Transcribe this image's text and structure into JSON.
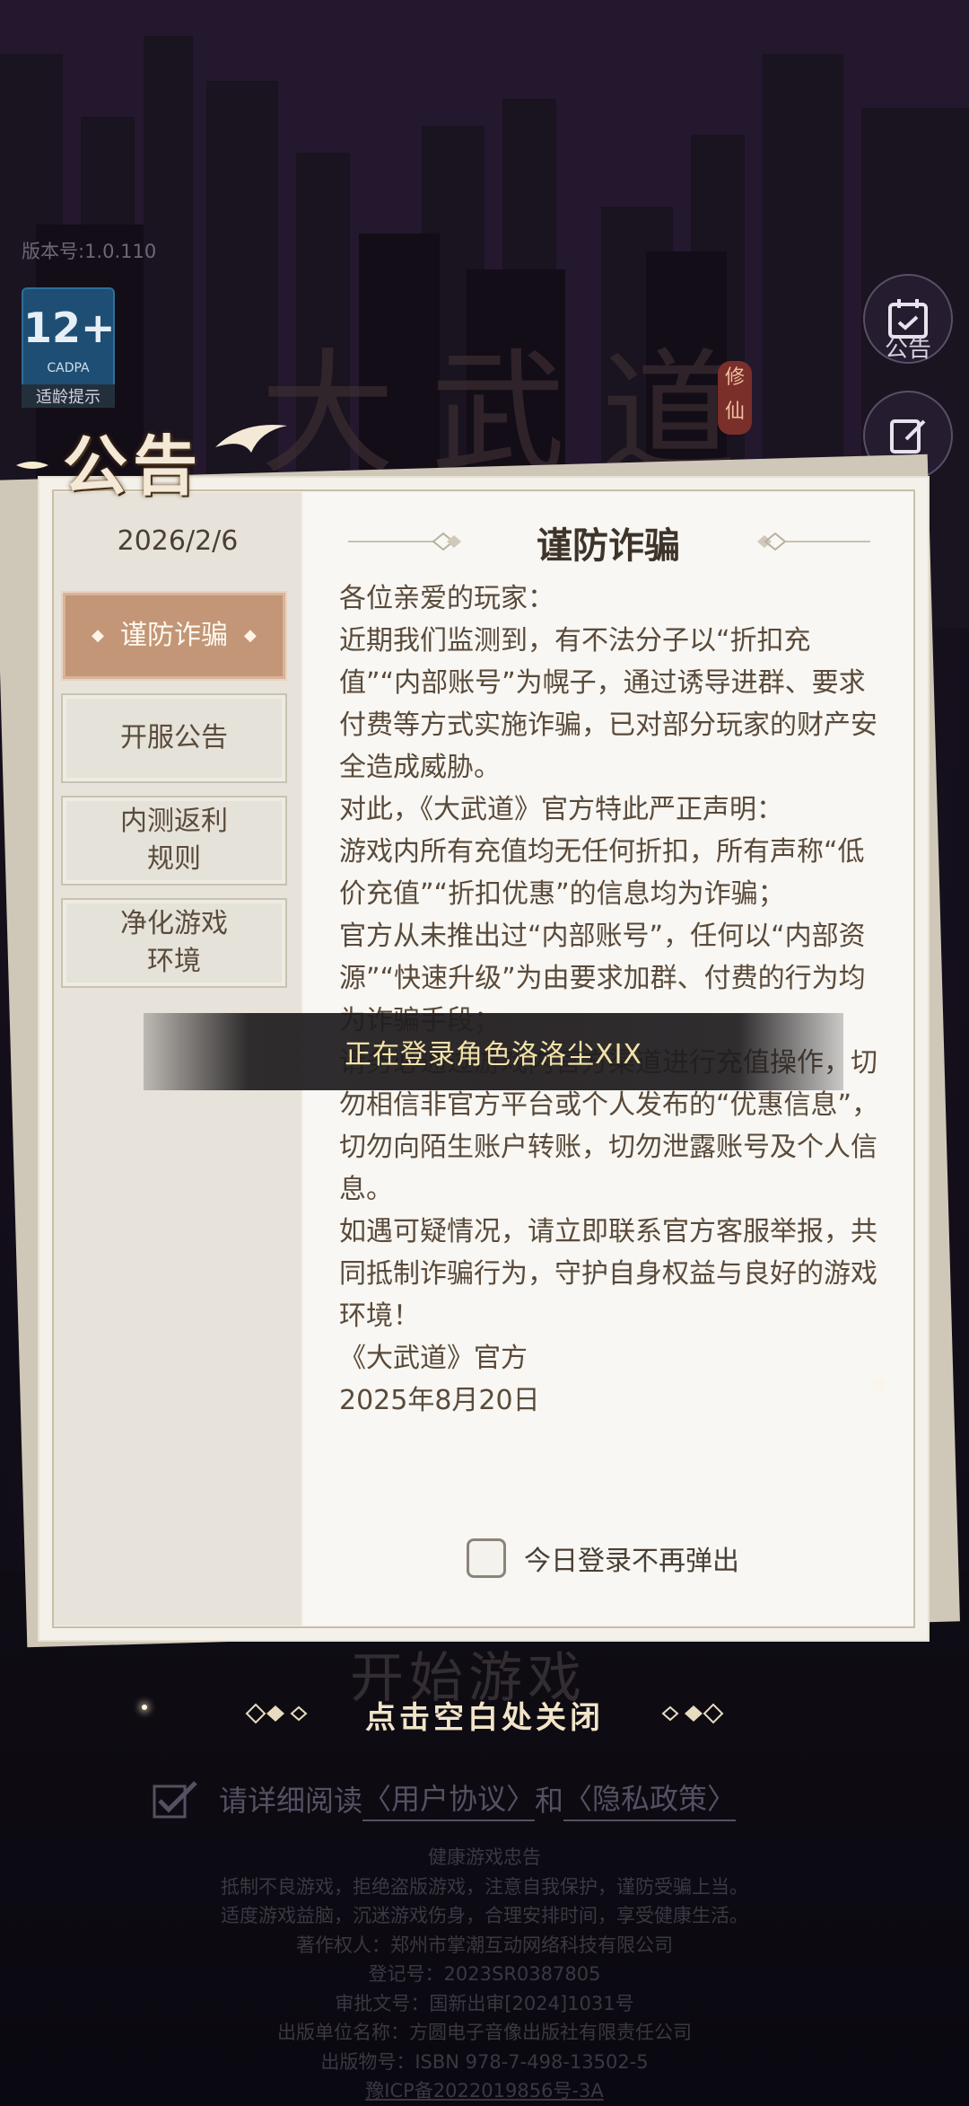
{
  "version": "版本号:1.0.110",
  "age_badge": {
    "rating": "12+",
    "org": "CADPA",
    "label": "适龄提示"
  },
  "side_buttons": {
    "notice_label": "公告"
  },
  "notice_header": "公告",
  "date": "2026/2/6",
  "tabs": [
    {
      "label": "谨防诈骗",
      "active": true
    },
    {
      "label": "开服公告",
      "active": false
    },
    {
      "label": "内测返利\n规则",
      "active": false
    },
    {
      "label": "净化游戏\n环境",
      "active": false
    }
  ],
  "article": {
    "title": "谨防诈骗",
    "paragraphs": [
      "各位亲爱的玩家：",
      "近期我们监测到，有不法分子以“折扣充值”“内部账号”为幌子，通过诱导进群、要求付费等方式实施诈骗，已对部分玩家的财产安全造成威胁。",
      "对此，《大武道》官方特此严正声明：",
      "游戏内所有充值均无任何折扣，所有声称“低价充值”“折扣优惠”的信息均为诈骗；",
      "官方从未推出过“内部账号”，任何以“内部资源”“快速升级”为由要求加群、付费的行为均为诈骗手段；",
      "请务必通过游戏内官方渠道进行充值操作，切勿相信非官方平台或个人发布的“优惠信息”，切勿向陌生账户转账，切勿泄露账号及个人信息。",
      "如遇可疑情况，请立即联系官方客服举报，共同抵制诈骗行为，守护自身权益与良好的游戏环境！",
      "《大武道》官方",
      "2025年8月20日"
    ]
  },
  "dont_show_today": "今日登录不再弹出",
  "toast": "正在登录角色洛洛尘XIX",
  "start_game_ghost": "开始游戏",
  "close_hint": "点击空白处关闭",
  "agreement": {
    "prefix": "请详细阅读",
    "user_agreement": "〈用户协议〉",
    "and": "和",
    "privacy_policy": "〈隐私政策〉"
  },
  "footer": {
    "lines": [
      "健康游戏忠告",
      "抵制不良游戏，拒绝盗版游戏，注意自我保护，谨防受骗上当。",
      "适度游戏益脑，沉迷游戏伤身，合理安排时间，享受健康生活。",
      "著作权人：郑州市掌潮互动网络科技有限公司",
      "登记号：2023SR0387805",
      "审批文号：国新出审[2024]1031号",
      "出版单位名称：方圆电子音像出版社有限责任公司",
      "出版物号：ISBN 978-7-498-13502-5"
    ],
    "icp": "豫ICP备2022019856号-3A"
  }
}
